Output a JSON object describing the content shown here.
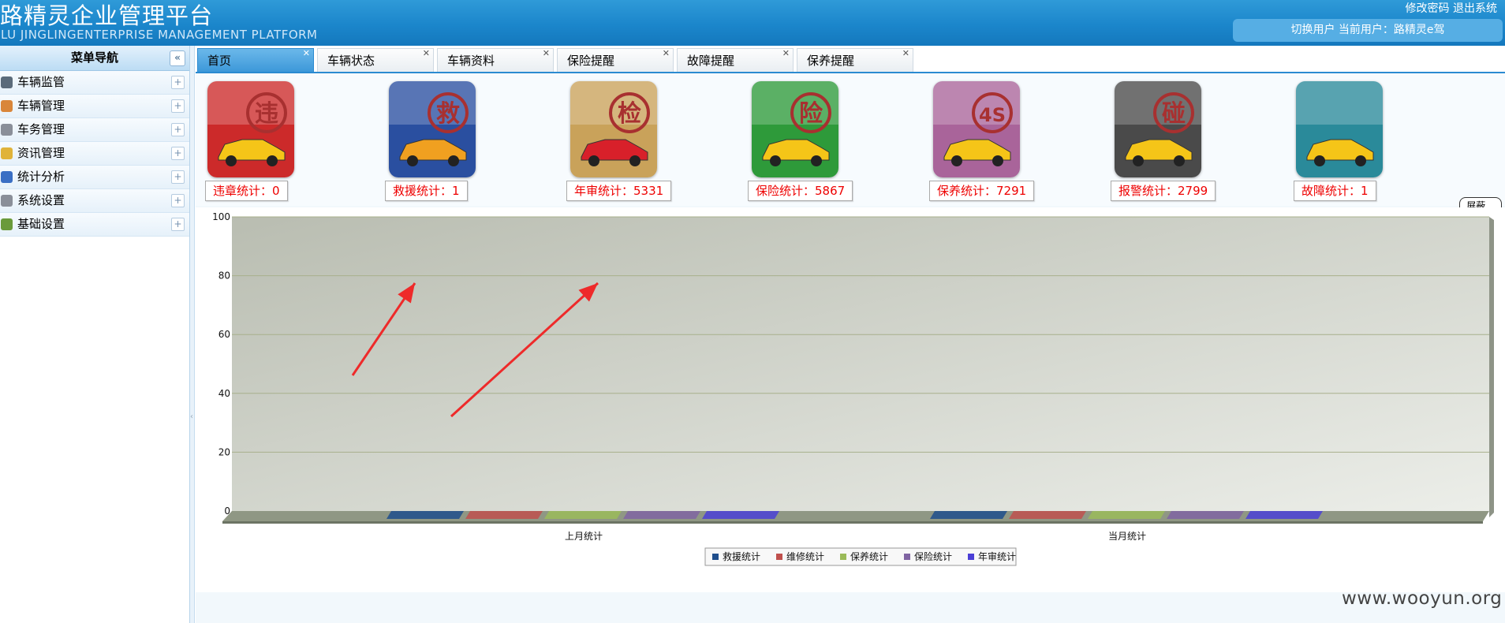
{
  "header": {
    "title": "路精灵企业管理平台",
    "subtitle": "LU JINGLINGENTERPRISE MANAGEMENT PLATFORM",
    "change_password": "修改密码",
    "logout": "退出系统",
    "switch_user": "切换用户",
    "current_user_label": "当前用户：",
    "current_user": "路精灵e驾"
  },
  "sidebar": {
    "title": "菜单导航",
    "collapse_icon": "«",
    "items": [
      {
        "label": "车辆监管",
        "icon": "monitor-icon",
        "color": "#5b6b7a"
      },
      {
        "label": "车辆管理",
        "icon": "user-car-icon",
        "color": "#d9863a"
      },
      {
        "label": "车务管理",
        "icon": "key-icon",
        "color": "#8a8f99"
      },
      {
        "label": "资讯管理",
        "icon": "edit-icon",
        "color": "#e0b33a"
      },
      {
        "label": "统计分析",
        "icon": "bar-chart-icon",
        "color": "#3a6fc4"
      },
      {
        "label": "系统设置",
        "icon": "gear-icon",
        "color": "#8a8f99"
      },
      {
        "label": "基础设置",
        "icon": "gears-icon",
        "color": "#6a9a3a"
      }
    ]
  },
  "tabs": [
    {
      "label": "首页",
      "active": true
    },
    {
      "label": "车辆状态",
      "active": false
    },
    {
      "label": "车辆资料",
      "active": false
    },
    {
      "label": "保险提醒",
      "active": false
    },
    {
      "label": "故障提醒",
      "active": false
    },
    {
      "label": "保养提醒",
      "active": false
    }
  ],
  "stats": [
    {
      "label": "违章统计：0",
      "glyph": "违",
      "icon": "violation-icon",
      "bg": "#cc2a2a"
    },
    {
      "label": "救援统计：1",
      "glyph": "救",
      "icon": "rescue-truck-icon",
      "bg": "#2a4fa0"
    },
    {
      "label": "年审统计：5331",
      "glyph": "检",
      "icon": "annual-inspection-icon",
      "bg": "#c9a25a"
    },
    {
      "label": "保险统计：5867",
      "glyph": "险",
      "icon": "insurance-icon",
      "bg": "#2e9a3a"
    },
    {
      "label": "保养统计：7291",
      "glyph": "4S",
      "icon": "maintenance-icon",
      "bg": "#a9649a"
    },
    {
      "label": "报警统计：2799",
      "glyph": "碰",
      "icon": "alarm-crash-icon",
      "bg": "#4a4a4a"
    },
    {
      "label": "故障统计：1",
      "glyph": "",
      "icon": "fault-repair-icon",
      "bg": "#2a8a9a"
    }
  ],
  "shield_button": "屏蔽...",
  "chart_data": {
    "type": "bar",
    "categories": [
      "上月统计",
      "当月统计"
    ],
    "ylim": [
      0,
      100
    ],
    "yticks": [
      0,
      20,
      40,
      60,
      80,
      100
    ],
    "series": [
      {
        "name": "救援统计",
        "values": [
          0,
          0
        ],
        "color": "#1f4e8c"
      },
      {
        "name": "维修统计",
        "values": [
          0,
          0
        ],
        "color": "#c0504d"
      },
      {
        "name": "保养统计",
        "values": [
          0,
          0
        ],
        "color": "#9bbb59"
      },
      {
        "name": "保险统计",
        "values": [
          0,
          0
        ],
        "color": "#8064a2"
      },
      {
        "name": "年审统计",
        "values": [
          0,
          0
        ],
        "color": "#4b3fd6"
      }
    ],
    "legend_position": "bottom",
    "grid": true
  },
  "watermark": "www.wooyun.org"
}
